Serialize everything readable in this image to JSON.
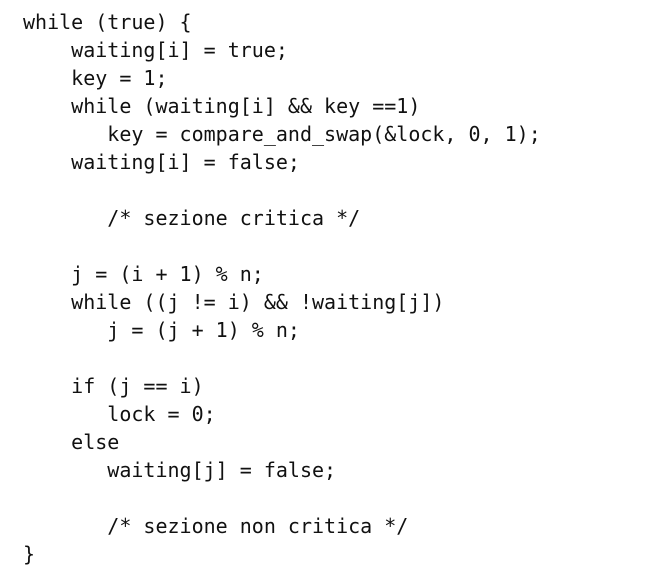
{
  "code": {
    "lines": [
      "while (true) {",
      "    waiting[i] = true;",
      "    key = 1;",
      "    while (waiting[i] && key ==1)",
      "       key = compare_and_swap(&lock, 0, 1);",
      "    waiting[i] = false;",
      "",
      "       /* sezione critica */",
      "",
      "    j = (i + 1) % n;",
      "    while ((j != i) && !waiting[j])",
      "       j = (j + 1) % n;",
      "",
      "    if (j == i)",
      "       lock = 0;",
      "    else",
      "       waiting[j] = false;",
      "",
      "       /* sezione non critica */",
      "}"
    ]
  }
}
